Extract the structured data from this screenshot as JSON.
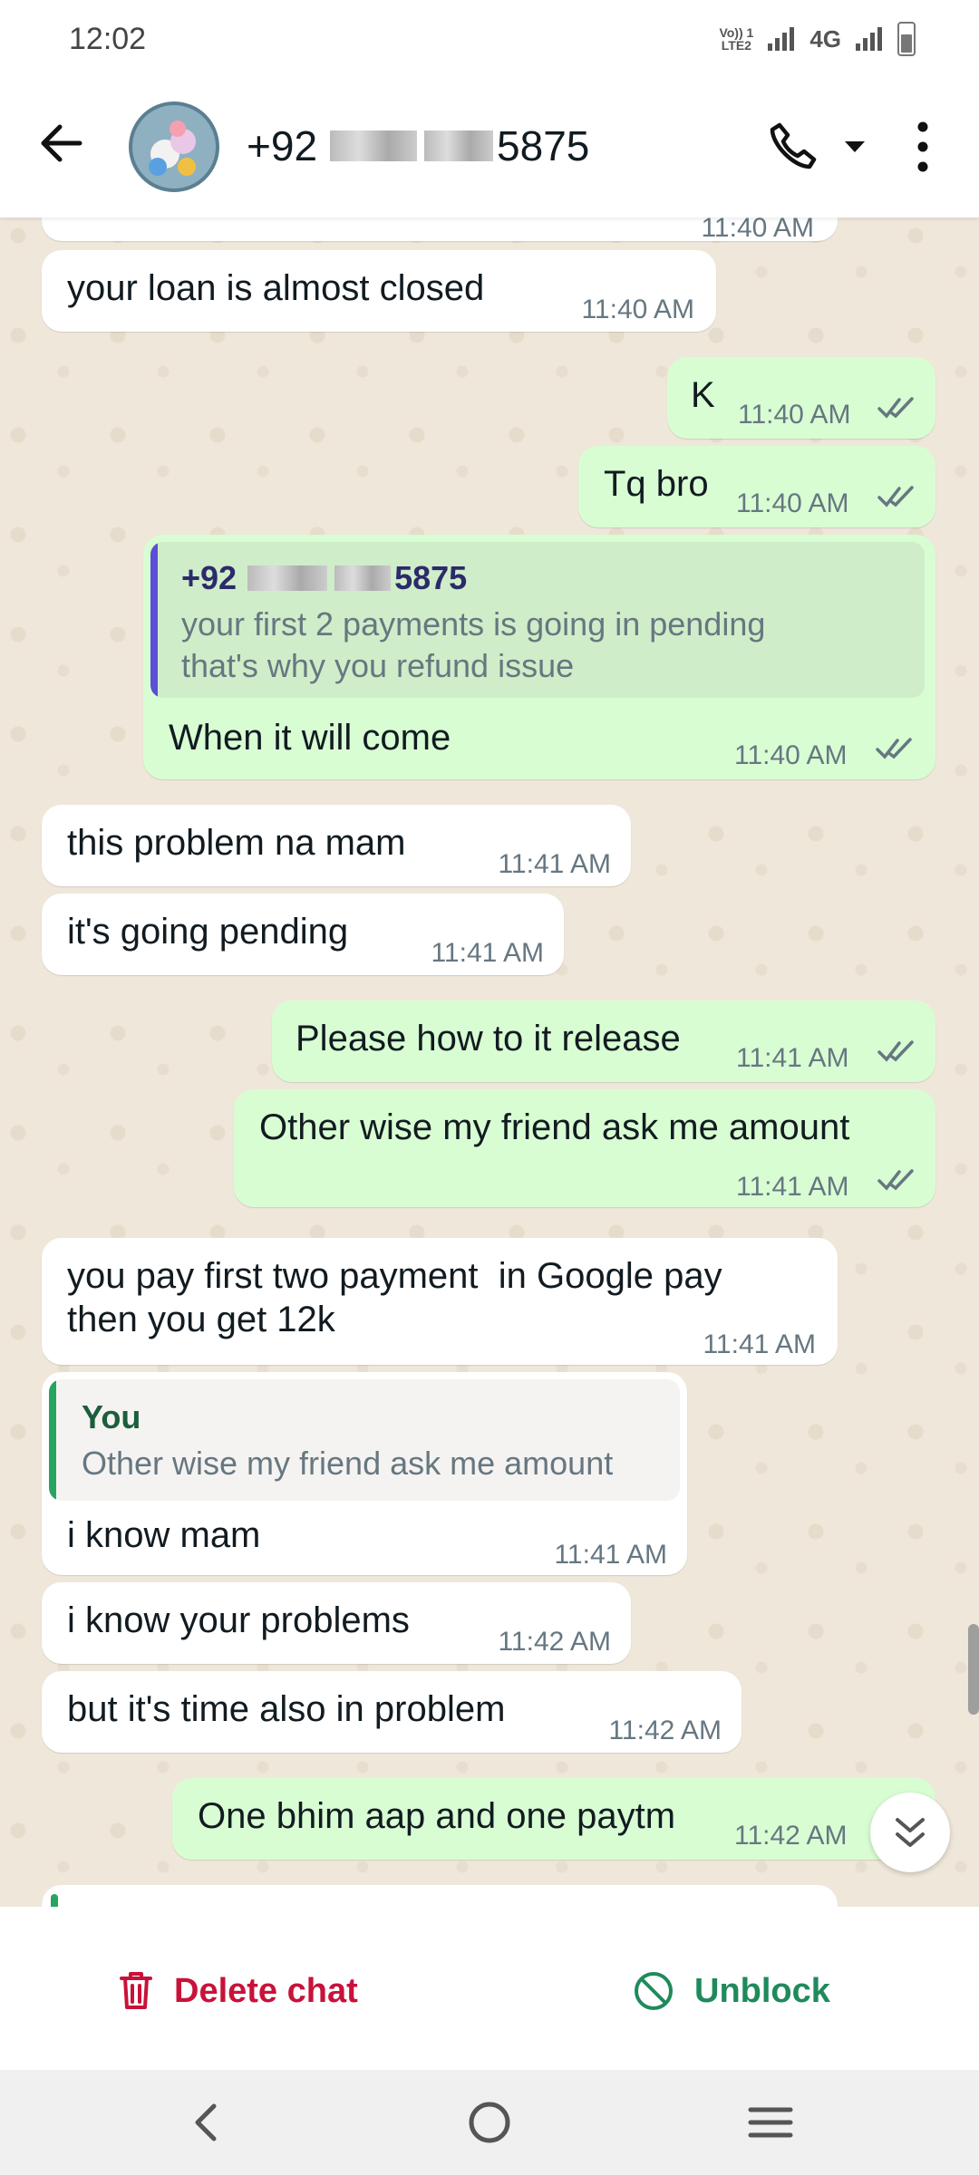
{
  "status_bar": {
    "time": "12:02",
    "volte_line1": "Vo)) 1",
    "volte_line2": "LTE2",
    "network": "4G"
  },
  "header": {
    "contact_prefix": "+92",
    "contact_suffix": "5875"
  },
  "messages": [
    {
      "text": "your loan is almost closed",
      "time": "11:40 AM"
    },
    {
      "text": "K",
      "time": "11:40 AM"
    },
    {
      "text": "Tq bro",
      "time": "11:40 AM"
    },
    {
      "quote_sender_prefix": "+92",
      "quote_sender_suffix": "5875",
      "quote_text": "your first 2 payments is going in pending\nthat's why you refund issue",
      "text": "When it will come",
      "time": "11:40 AM"
    },
    {
      "text": "this problem na mam",
      "time": "11:41 AM"
    },
    {
      "text": "it's going pending",
      "time": "11:41 AM"
    },
    {
      "text": "Please how to it release",
      "time": "11:41 AM"
    },
    {
      "text": "Other wise my friend ask me amount",
      "time": "11:41 AM"
    },
    {
      "text": "you pay first two payment  in Google pay\nthen you get 12k",
      "time": "11:41 AM"
    },
    {
      "quote_sender": "You",
      "quote_text": "Other wise my friend ask me amount",
      "text": "i know mam",
      "time": "11:41 AM"
    },
    {
      "text": "i know your problems",
      "time": "11:42 AM"
    },
    {
      "text": "but it's time also in problem",
      "time": "11:42 AM"
    },
    {
      "text": "One bhim aap and one paytm",
      "time": "11:42 AM"
    }
  ],
  "actions": {
    "delete": "Delete chat",
    "unblock": "Unblock"
  },
  "colors": {
    "outgoing": "#d9fdd3",
    "incoming": "#ffffff",
    "delete": "#c8123a",
    "unblock": "#1f8a5b",
    "quote_bar_contact": "#5b4fd6",
    "quote_bar_you": "#25a55f"
  },
  "icons": [
    "back-arrow-icon",
    "phone-icon",
    "caret-down-icon",
    "more-vert-icon",
    "double-check-icon",
    "scroll-down-icon",
    "trash-icon",
    "block-icon",
    "nav-back-icon",
    "nav-home-icon",
    "nav-recent-icon"
  ]
}
